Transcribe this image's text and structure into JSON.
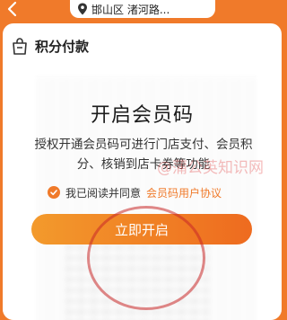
{
  "topbar": {
    "location": "邯山区 渚河路..."
  },
  "card": {
    "title": "积分付款"
  },
  "modal": {
    "title": "开启会员码",
    "description": "授权开通会员码可进行门店支付、会员积分、核销到店卡券等功能",
    "agree_text": "我已阅读并同意",
    "agree_link": "会员码用户协议",
    "button_label": "立即开启"
  },
  "watermark": "@蒲公英知识网",
  "colors": {
    "accent": "#f07a2a",
    "button_gradient_start": "#f39a2c",
    "button_gradient_end": "#ee6b1f",
    "annotation_circle": "#c82828"
  }
}
